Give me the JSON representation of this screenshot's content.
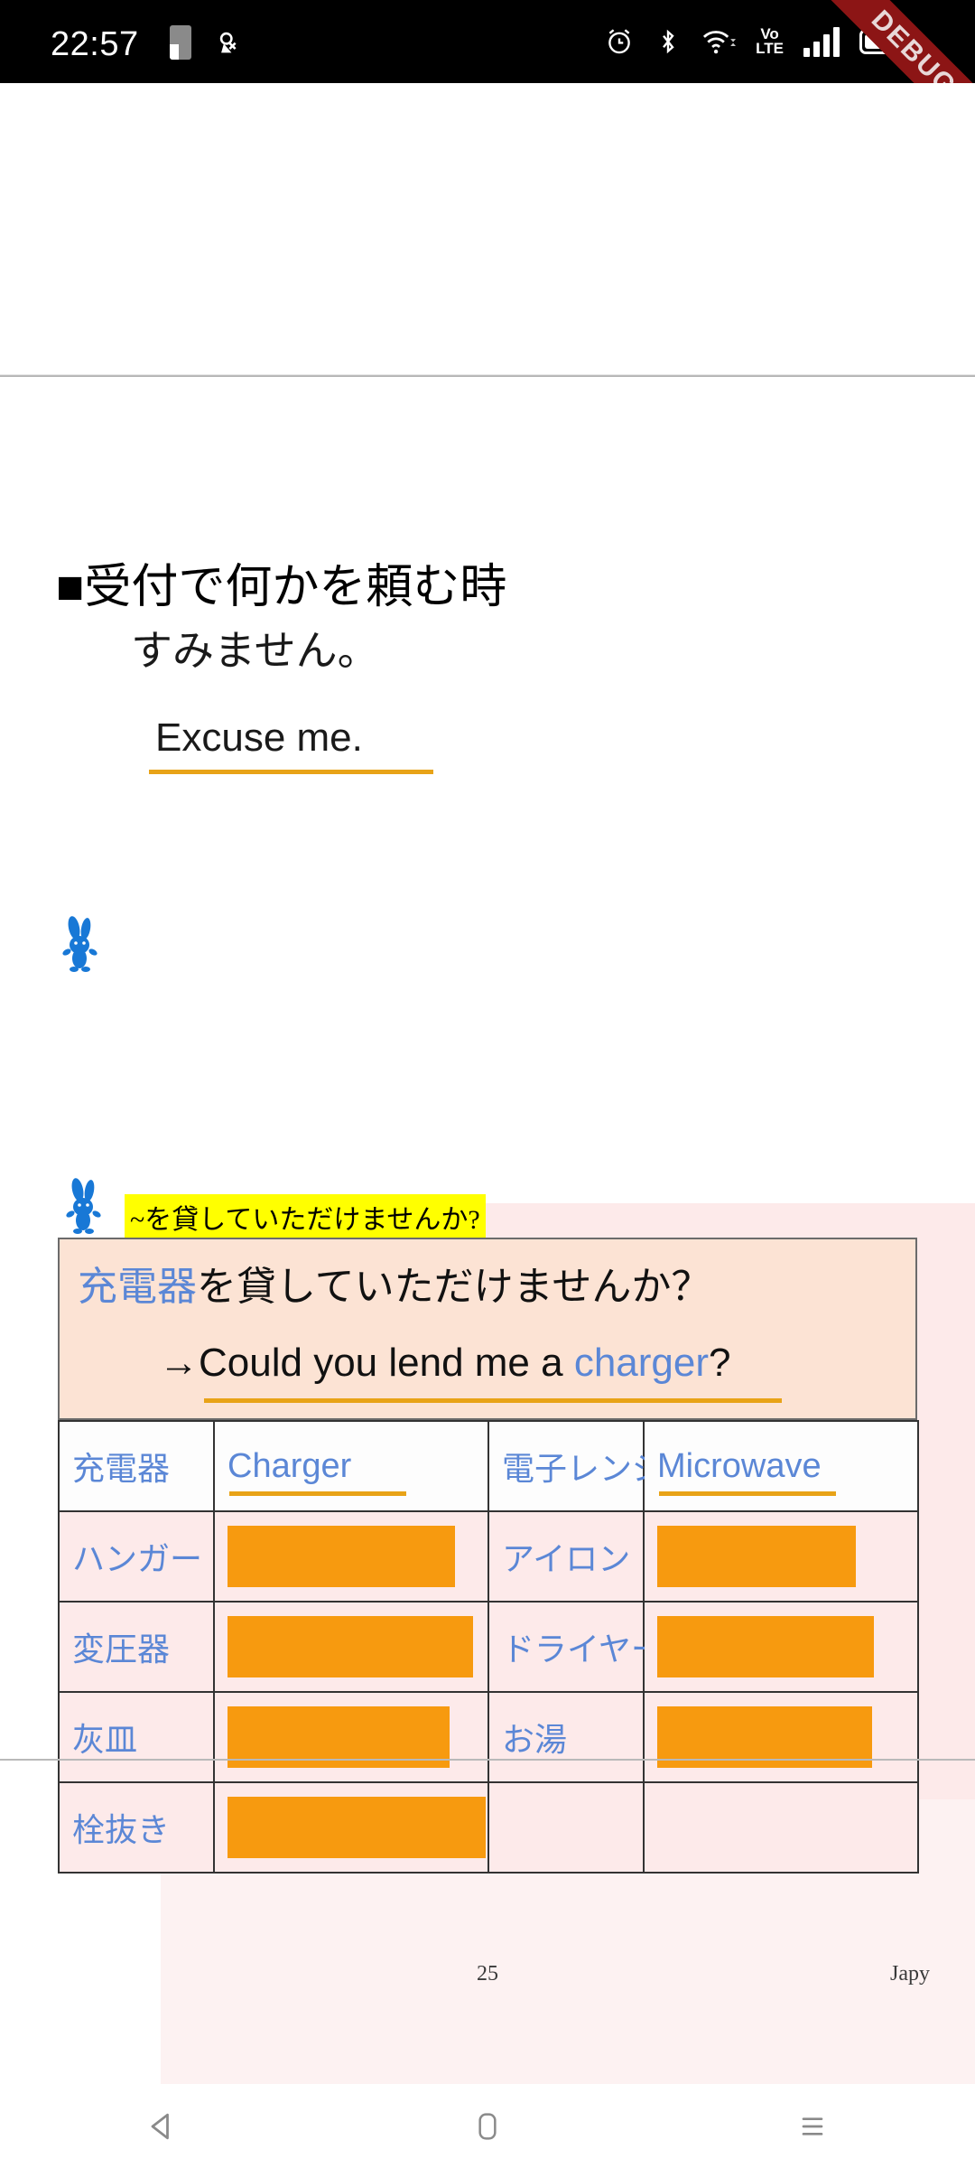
{
  "status_bar": {
    "clock": "22:57",
    "icons_left": [
      "sim-card-icon",
      "no-data-icon"
    ],
    "icons_right": [
      "alarm-clock-icon",
      "bluetooth-icon",
      "wifi-icon",
      "volte-icon",
      "signal-bars-icon",
      "battery-icon"
    ],
    "volte_top": "Vo",
    "volte_bottom": "LTE",
    "debug_ribbon": "DEBUG",
    "ribbon_color": "#8c1515"
  },
  "document": {
    "heading": "■受付で何かを頼む時",
    "line1_jp": "すみません。",
    "line1_en": "Excuse me.",
    "prompt_highlight": "~を貸していただけませんか?",
    "example": {
      "jp_keyword": "充電器",
      "jp_rest": "を貸していただけませんか？",
      "en_arrow": "→",
      "en_before": "Could you lend me a ",
      "en_keyword": "charger",
      "en_after": "?"
    },
    "table": {
      "rows": [
        {
          "left_jp": "充電器",
          "left_en": "Charger",
          "left_en_filled": true,
          "right_jp": "電子レンジ",
          "right_en": "Microwave",
          "right_en_filled": true
        },
        {
          "left_jp": "ハンガー",
          "left_en": "",
          "left_en_filled": false,
          "right_jp": "アイロン",
          "right_en": "",
          "right_en_filled": false
        },
        {
          "left_jp": "変圧器",
          "left_en": "",
          "left_en_filled": false,
          "right_jp": "ドライヤー",
          "right_en": "",
          "right_en_filled": false
        },
        {
          "left_jp": "灰皿",
          "left_en": "",
          "left_en_filled": false,
          "right_jp": "お湯",
          "right_en": "",
          "right_en_filled": false
        },
        {
          "left_jp": "栓抜き",
          "left_en": "",
          "left_en_filled": false,
          "right_jp": "",
          "right_en": "",
          "right_en_filled": false
        }
      ]
    },
    "footer_page_number": "25",
    "footer_brand": "Japy"
  },
  "nav_bar": {
    "back": "back-icon",
    "home": "home-icon",
    "recents": "recents-icon"
  },
  "colors": {
    "accent_orange": "#f79a0f",
    "underline_orange": "#e8a317",
    "keyword_blue": "#5b87d6",
    "highlight_yellow": "#ffff00",
    "example_peach": "#fce3d4",
    "row_pink": "#fdeaea"
  }
}
